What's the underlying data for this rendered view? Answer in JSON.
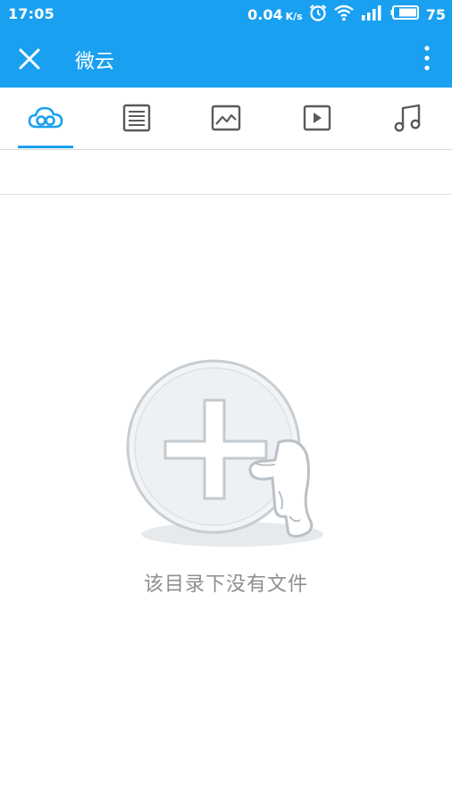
{
  "status_bar": {
    "time": "17:05",
    "speed_value": "0.04",
    "speed_unit": "K/s",
    "battery_level": "75",
    "icons": [
      "alarm-icon",
      "wifi-icon",
      "signal-icon",
      "battery-icon"
    ]
  },
  "toolbar": {
    "title": "微云",
    "close_icon": "close-icon",
    "more_icon": "more-vertical-icon"
  },
  "tabs": [
    {
      "name": "cloud",
      "icon": "cloud-icon",
      "selected": true
    },
    {
      "name": "documents",
      "icon": "document-icon",
      "selected": false
    },
    {
      "name": "images",
      "icon": "image-icon",
      "selected": false
    },
    {
      "name": "videos",
      "icon": "video-icon",
      "selected": false
    },
    {
      "name": "music",
      "icon": "music-icon",
      "selected": false
    }
  ],
  "empty_state": {
    "message": "该目录下没有文件",
    "illustration": "empty-folder-mascot"
  },
  "colors": {
    "accent": "#1aa0f0",
    "tab_icon": "#5a5a5a",
    "empty_text": "#8e8e8e"
  }
}
